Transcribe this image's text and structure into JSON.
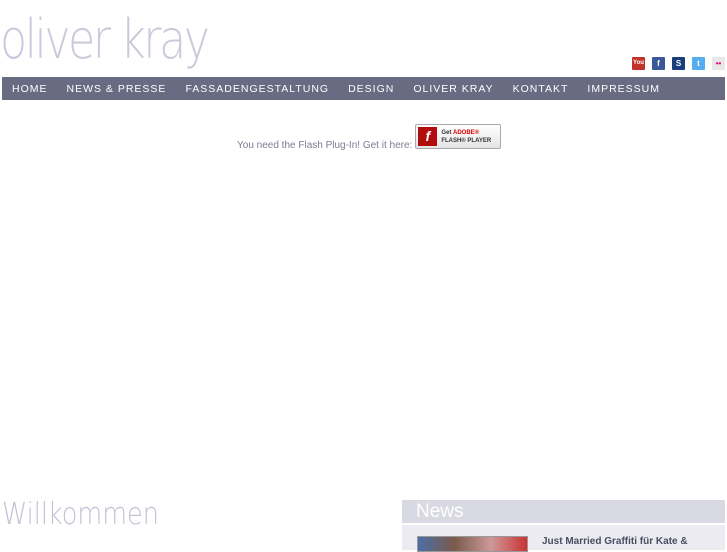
{
  "logo": "oliver kray",
  "social": [
    {
      "name": "youtube",
      "label": "You",
      "color": "#c4302b"
    },
    {
      "name": "facebook",
      "label": "f",
      "color": "#3b5998"
    },
    {
      "name": "myspace",
      "label": "S",
      "color": "#1a3d7c"
    },
    {
      "name": "twitter",
      "label": "t",
      "color": "#55acee"
    },
    {
      "name": "flickr",
      "label": "••",
      "color": "#ddd"
    }
  ],
  "nav": [
    "HOME",
    "NEWS & PRESSE",
    "FASSADENGESTALTUNG",
    "DESIGN",
    "OLIVER KRAY",
    "KONTAKT",
    "IMPRESSUM"
  ],
  "flash": {
    "text": "You need the Flash Plug-In! Get it here:",
    "button_get": "Get",
    "button_adobe": "ADOBE®",
    "button_player": "FLASH® PLAYER"
  },
  "welcome": "Willkommen",
  "news": {
    "title": "News",
    "item_title": "Just Married Graffiti für Kate &"
  }
}
